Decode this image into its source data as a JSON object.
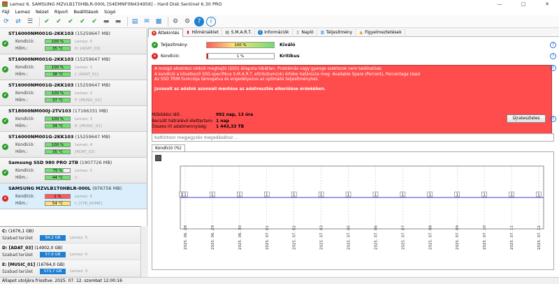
{
  "window": {
    "title": "Lemez 6. SAMSUNG MZVLB1T0HBLR-000L [S4EMNF0N434956] - Hard Disk Sentinel 6.30 PRO",
    "minimize": "—",
    "maximize": "□",
    "close": "✕"
  },
  "menu": [
    "Fájl",
    "Lemez",
    "Nézet",
    "Riport",
    "Beállítások",
    "Súgó"
  ],
  "disks": [
    {
      "name": "ST16000NM001G-2KK103",
      "size": "(15259647 MB)",
      "health": "100 %",
      "health_value": 100,
      "temp": "35 °C",
      "disk_label": "Lemez: 0",
      "drive": "D: [ADAT_03]",
      "status": "ok"
    },
    {
      "name": "ST16000NM001G-2KK103",
      "size": "(15259647 MB)",
      "health": "100 %",
      "health_value": 100,
      "temp": "38 °C",
      "disk_label": "Lemez: 1",
      "drive": "J: [ADAT_01]",
      "status": "ok"
    },
    {
      "name": "ST16000NM001G-2KK103",
      "size": "(15259647 MB)",
      "health": "100 %",
      "health_value": 100,
      "temp": "37 °C",
      "disk_label": "Lemez: 2",
      "drive": "F: [MUSIC_02]",
      "status": "ok"
    },
    {
      "name": "ST18000NM000J-2TV103",
      "size": "(17166331 MB)",
      "health": "100 %",
      "health_value": 100,
      "temp": "34 °C",
      "disk_label": "Lemez: 3",
      "drive": "E: [MUSIC_01]",
      "status": "ok"
    },
    {
      "name": "ST16000NM001G-2KK103",
      "size": "(15259647 MB)",
      "health": "100 %",
      "health_value": 100,
      "temp": "35 °C",
      "disk_label": "Lemez: 4",
      "drive": "[ADAT_02]",
      "status": "ok"
    },
    {
      "name": "Samsung SSD 980 PRO 2TB",
      "size": "(1907726 MB)",
      "health": "75 %",
      "health_value": 75,
      "temp": "44 °C",
      "disk_label": "Lemez: 5",
      "drive": "C:",
      "status": "ok"
    },
    {
      "name": "SAMSUNG MZVLB1T0HBLR-000L",
      "size": "(976756 MB)",
      "health": "1 %",
      "health_value": 1,
      "temp": "54 °C",
      "disk_label": "Lemez: 6",
      "drive": "I: [1TB_NVME]",
      "status": "bad"
    }
  ],
  "disk_labels": {
    "health": "Kondíció:",
    "temp": "Hőm.:"
  },
  "drives": [
    {
      "name": "C:",
      "size": "(1676,1 GB)",
      "free_label": "Szabad terület",
      "free": "94,2 GB",
      "disk": "Lemez: 5"
    },
    {
      "name": "D: [ADAT_03]",
      "size": "(14902,0 GB)",
      "free_label": "Szabad terület",
      "free": "57,9 GB",
      "disk": "Lemez: 0"
    },
    {
      "name": "E: [MUSIC_01]",
      "size": "(16764,0 GB)",
      "free_label": "Szabad terület",
      "free": "573,7 GB",
      "disk": "Lemez: 3"
    }
  ],
  "tabs": [
    "Áttekintés",
    "Hőmérséklet",
    "S.M.A.R.T.",
    "Információk",
    "Napló",
    "Teljesítmény",
    "Figyelmeztetések"
  ],
  "overview": {
    "perf_label": "Teljesítmény:",
    "perf_value": "100 %",
    "perf_pct": 100,
    "perf_verdict": "Kiváló",
    "health_label": "Kondíció:",
    "health_value": "1 %",
    "health_pct": 1,
    "health_verdict": "Kritikus",
    "alert_lines": [
      "A mozgó alkatrész nélküli meghajtó (SSD) állapota hibátlan. Problémás vagy gyenge szektorok nem találhatóak.",
      "A kondíció a következő SSD-specifikus S.M.A.R.T. attribútum(ok) értéke határozza meg:  Available Spare (Percent), Percentage Used",
      "Az SSD TRIM funkciója támogatva és engedélyezve az optimális teljesítményhez."
    ],
    "alert_strong": "Javasolt az adatok azonnali mentése az adatvesztés elkerülése érdekében.",
    "stats": [
      {
        "k": "Működési idő:",
        "v": "992 nap, 13 óra"
      },
      {
        "k": "Becsült hátralévő élettartam:",
        "v": "1 nap"
      },
      {
        "k": "Összes írt adatmennyiség:",
        "v": "1 443,33 TB"
      }
    ],
    "reset_button": "Újrateszteles",
    "comment_placeholder": "Kattintson megjegyzés megadásához ...",
    "chart_tab": "Kondíció  (%)"
  },
  "chart_data": {
    "type": "line",
    "x": [
      "2025. 06. 28",
      "2025. 06. 29",
      "2025. 06. 30",
      "2025. 07. 01",
      "2025. 07. 02",
      "2025. 07. 03",
      "2025. 07. 05",
      "2025. 07. 06",
      "2025. 07. 07",
      "2025. 07. 08",
      "2025. 07. 09",
      "2025. 07. 10",
      "2025. 07. 11",
      "2025. 07. 12"
    ],
    "series": [
      {
        "values": [
          1,
          1,
          1,
          1,
          1,
          1,
          1,
          1,
          1,
          1,
          1,
          1,
          1,
          1
        ]
      }
    ],
    "ylim": [
      0,
      2
    ],
    "grid": true,
    "line_color": "#3d3dd6",
    "point_labels": [
      "1",
      "1",
      "1",
      "1",
      "1",
      "1",
      "1",
      "1",
      "1",
      "1",
      "1",
      "1",
      "1",
      "1",
      "1"
    ]
  },
  "statusbar": "Állapot utoljára frissítve: 2025. 07. 12. szombat 12:00:16",
  "colors": {
    "ok": "#2a9d2a",
    "bad": "#d22222",
    "good_bar": "#6ee06e",
    "bad_bar": "#ff4d4d",
    "alert": "#ff4d4d",
    "drive_bar": "#1f7fd2"
  }
}
